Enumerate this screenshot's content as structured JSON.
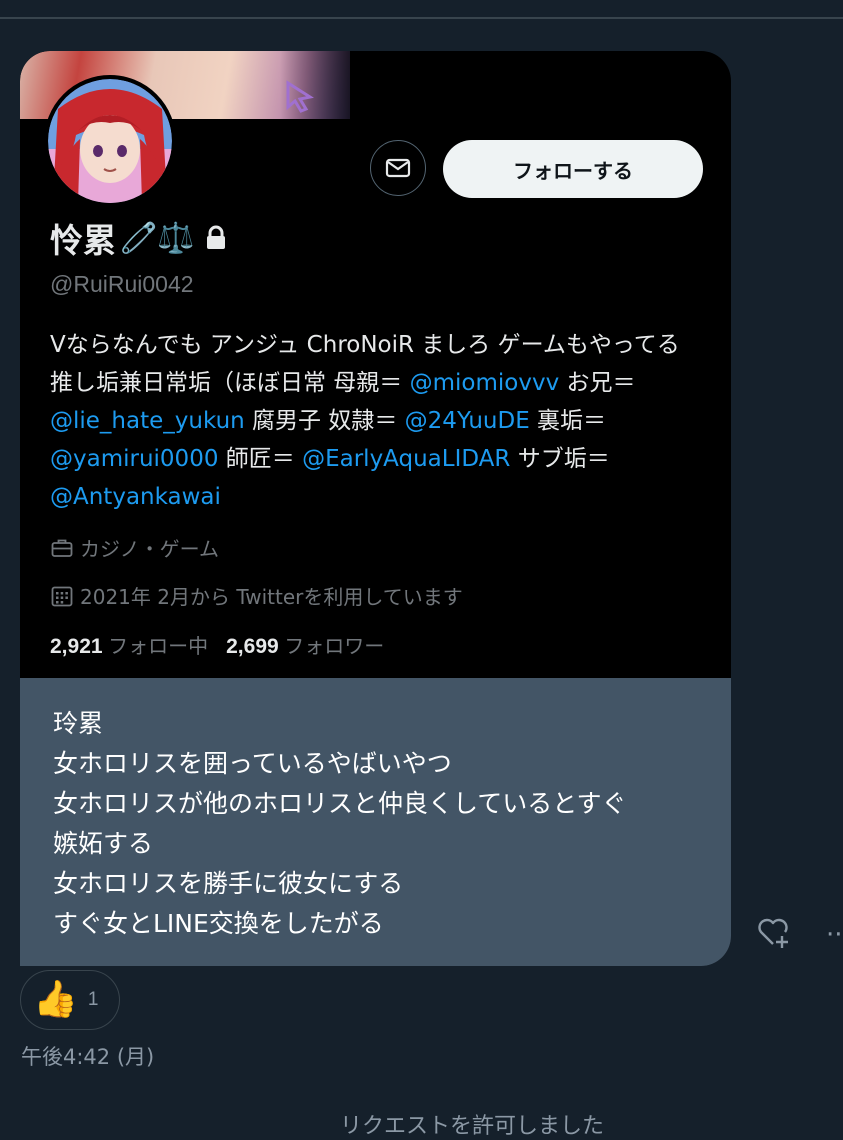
{
  "profile": {
    "display_name": "怜累",
    "name_emojis": "🧷⚖️",
    "lock_icon": "lock-icon",
    "handle": "@RuiRui0042",
    "follow_label": "フォローする",
    "category": "カジノ・ゲーム",
    "joined": "2021年 2月から Twitterを利用しています",
    "following_count": "2,921",
    "following_label": "フォロー中",
    "followers_count": "2,699",
    "followers_label": "フォロワー",
    "bio": {
      "t1": "Vならなんでも アンジュ ChroNoiR ましろ ゲームもやってる 推し垢兼日常垢（ほぼ日常 母親＝ ",
      "m1": "@miomiovvv",
      "t2": " お兄＝ ",
      "m2": "@lie_hate_yukun",
      "t3": " 腐男子 奴隷＝ ",
      "m3": "@24YuuDE",
      "t4": " 裏垢＝ ",
      "m4": "@yamirui0000",
      "t5": " 師匠＝ ",
      "m5": "@EarlyAquaLIDAR",
      "t6": " サブ垢＝ ",
      "m6": "@Antyankawai"
    }
  },
  "message": {
    "lines": [
      "玲累",
      "女ホロリスを囲っているやばいやつ",
      "女ホロリスが他のホロリスと仲良くしているとすぐ",
      "嫉妬する",
      "女ホロリスを勝手に彼女にする",
      "すぐ女とLINE交換をしたがる"
    ]
  },
  "reaction": {
    "emoji": "👍",
    "count": "1"
  },
  "timestamp": "午後4:42 (月)",
  "bottom_text": "リクエストを許可しました",
  "colors": {
    "background": "#15202b",
    "card": "#000000",
    "bubble": "#435566",
    "mention": "#1d9bf0",
    "muted": "#71767b"
  }
}
